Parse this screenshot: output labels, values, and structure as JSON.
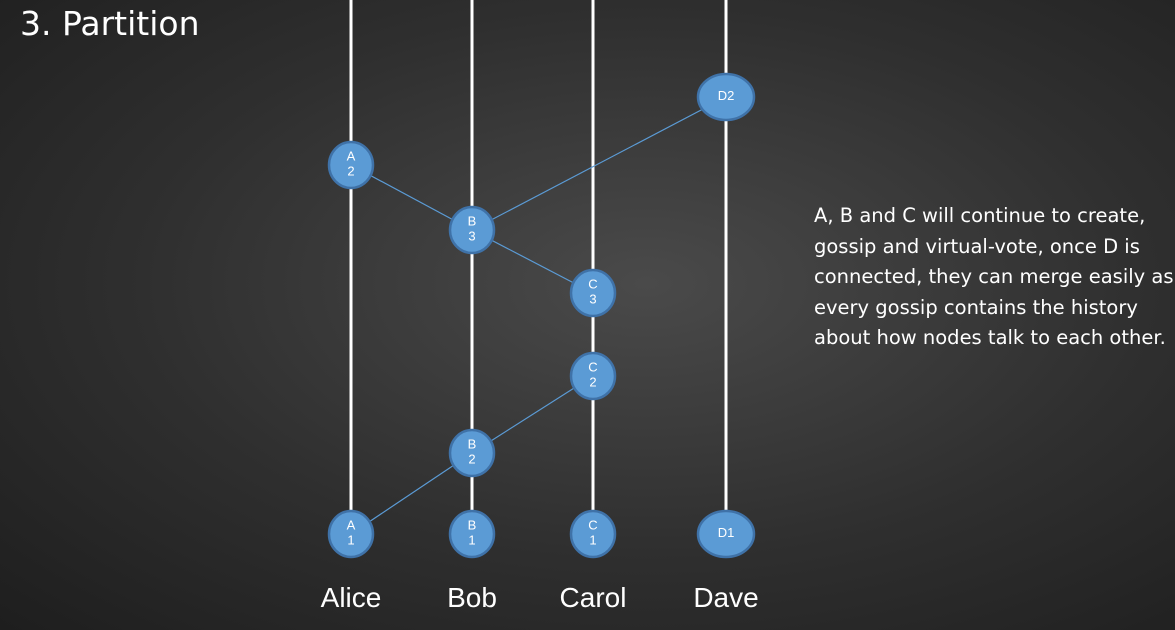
{
  "slide": {
    "title": "3. Partition",
    "description": "A, B and C will continue to create, gossip and virtual-vote, once D is connected, they can merge easily as every gossip contains the history about how nodes talk to each other."
  },
  "colors": {
    "node_fill": "#5b9bd5",
    "node_stroke": "#3f72a8",
    "edge": "#5b9bd5",
    "lifeline": "#ffffff",
    "text": "#ffffff"
  },
  "participants": [
    {
      "id": "alice",
      "name": "Alice"
    },
    {
      "id": "bob",
      "name": "Bob"
    },
    {
      "id": "carol",
      "name": "Carol"
    },
    {
      "id": "dave",
      "name": "Dave"
    }
  ],
  "events": [
    {
      "id": "A1",
      "participant": "alice",
      "label": "A\n1"
    },
    {
      "id": "A2",
      "participant": "alice",
      "label": "A\n2"
    },
    {
      "id": "B1",
      "participant": "bob",
      "label": "B\n1"
    },
    {
      "id": "B2",
      "participant": "bob",
      "label": "B\n2"
    },
    {
      "id": "B3",
      "participant": "bob",
      "label": "B\n3"
    },
    {
      "id": "C1",
      "participant": "carol",
      "label": "C\n1"
    },
    {
      "id": "C2",
      "participant": "carol",
      "label": "C\n2"
    },
    {
      "id": "C3",
      "participant": "carol",
      "label": "C\n3"
    },
    {
      "id": "D1",
      "participant": "dave",
      "label": "D1"
    },
    {
      "id": "D2",
      "participant": "dave",
      "label": "D2"
    }
  ],
  "edges": [
    {
      "from": "A1",
      "to": "B2"
    },
    {
      "from": "B2",
      "to": "C2"
    },
    {
      "from": "A2",
      "to": "B3"
    },
    {
      "from": "B3",
      "to": "C3"
    },
    {
      "from": "B3",
      "to": "D2"
    }
  ]
}
